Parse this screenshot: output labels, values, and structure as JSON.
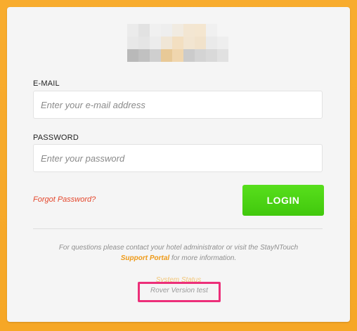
{
  "colors": {
    "background": "#f7a929",
    "card": "#f5f5f5",
    "login_button": "#4bd313",
    "forgot_password": "#e4462b",
    "support_link": "#ee9a18",
    "highlight_box": "#ec2f79"
  },
  "logo": {
    "redacted": true,
    "pixel_colors": [
      [
        "#ebebeb",
        "#e2e2e2",
        "#f0f0f0",
        "#eeeeee",
        "#f1ebe1",
        "#f3e6d2",
        "#f4e6d0",
        "#f0f0f0",
        "#f5f5f5"
      ],
      [
        "#e8e8e8",
        "#e5e5e5",
        "#ececec",
        "#f0e6d6",
        "#f3dfc1",
        "#f2e5d1",
        "#f1e2cb",
        "#eaeaea",
        "#eeeeee"
      ],
      [
        "#b9b9b9",
        "#c1c1c1",
        "#cfcfcf",
        "#e8c997",
        "#f0d6ae",
        "#cbcbcb",
        "#d4d4d4",
        "#d9d9d9",
        "#e1e1e1"
      ]
    ]
  },
  "form": {
    "email": {
      "label": "E-MAIL",
      "value": "",
      "placeholder": "Enter your e-mail address"
    },
    "password": {
      "label": "PASSWORD",
      "value": "",
      "placeholder": "Enter your password"
    },
    "forgot_password_label": "Forgot Password?",
    "login_button_label": "LOGIN"
  },
  "footer": {
    "help_text_before": "For questions please contact your hotel administrator or visit the StayNTouch",
    "support_link_label": "Support Portal",
    "help_text_after": "for more information.",
    "system_status_label": "System Status",
    "version_label": "Rover Version test"
  }
}
